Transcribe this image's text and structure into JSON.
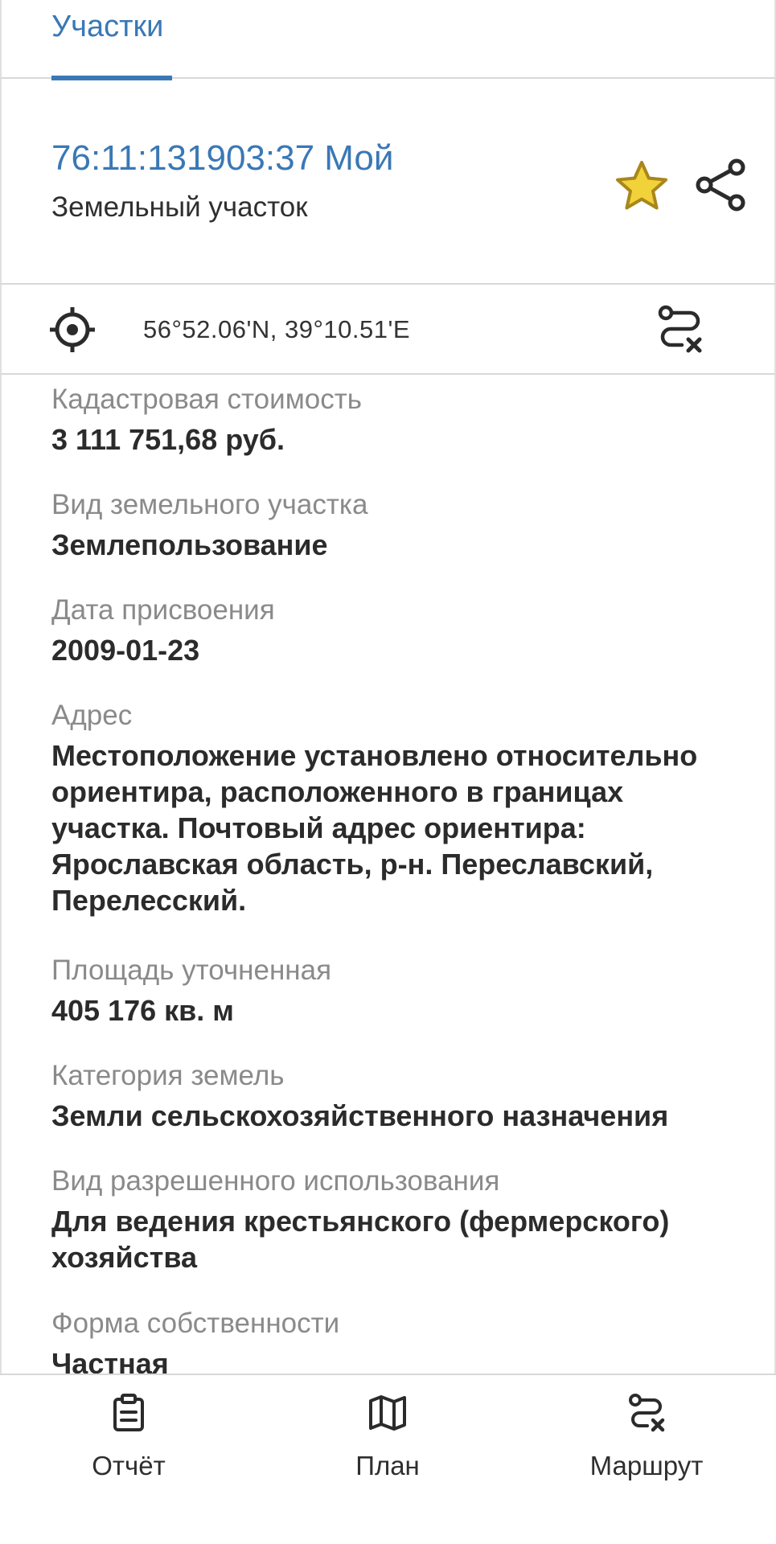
{
  "tabs": [
    {
      "label": "Участки",
      "active": true
    }
  ],
  "parcel": {
    "id_line": "76:11:131903:37 Мой",
    "type": "Земельный участок",
    "favorite": true
  },
  "location": {
    "coordinates": "56°52.06'N, 39°10.51'E"
  },
  "properties": [
    {
      "label": "Кадастровая стоимость",
      "value": "3 111 751,68 руб."
    },
    {
      "label": "Вид земельного участка",
      "value": "Землепользование"
    },
    {
      "label": "Дата присвоения",
      "value": "2009-01-23"
    },
    {
      "label": "Адрес",
      "value": "Местоположение установлено относительно ориентира, расположенного в границах участка. Почтовый адрес ориентира: Ярославская область, р-н. Переславский, Перелесский."
    },
    {
      "label": "Площадь уточненная",
      "value": "405 176 кв. м"
    },
    {
      "label": "Категория земель",
      "value": "Земли сельскохозяйственного назначения"
    },
    {
      "label": "Вид разрешенного использования",
      "value": "Для ведения крестьянского (фермерского) хозяйства"
    },
    {
      "label": "Форма собственности",
      "value": "Частная"
    }
  ],
  "bottom_nav": [
    {
      "label": "Отчёт",
      "icon": "clipboard-icon"
    },
    {
      "label": "План",
      "icon": "map-icon"
    },
    {
      "label": "Маршрут",
      "icon": "route-icon"
    }
  ],
  "colors": {
    "accent": "#3a78b5",
    "star_fill": "#f2d23a",
    "star_stroke": "#a8871a",
    "label_gray": "#8a8a8a",
    "text_dark": "#2b2b2b"
  }
}
